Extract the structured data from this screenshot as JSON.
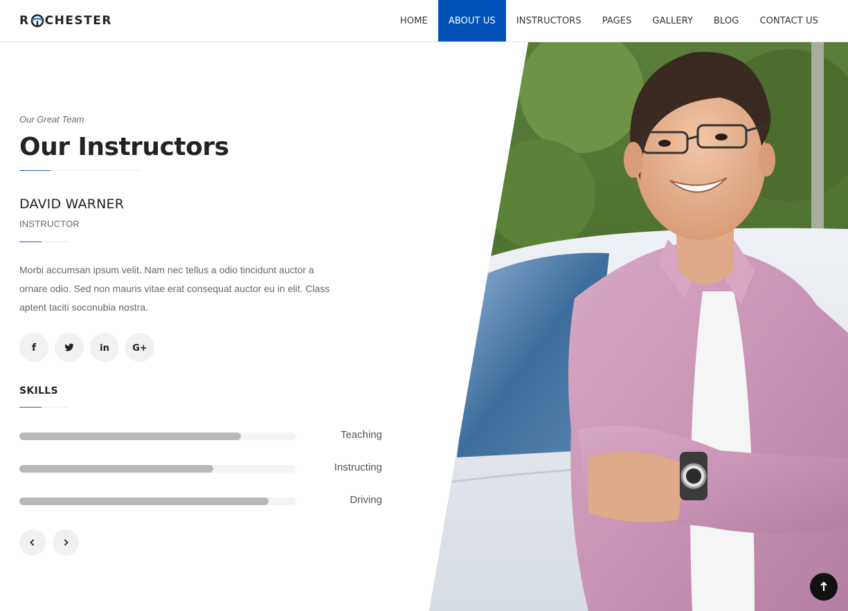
{
  "header": {
    "logo_left": "R",
    "logo_right": "CHESTER",
    "nav": [
      {
        "label": "HOME"
      },
      {
        "label": "ABOUT US"
      },
      {
        "label": "INSTRUCTORS"
      },
      {
        "label": "PAGES"
      },
      {
        "label": "GALLERY"
      },
      {
        "label": "BLOG"
      },
      {
        "label": "CONTACT US"
      }
    ],
    "active_nav": "ABOUT US"
  },
  "section": {
    "eyebrow": "Our Great Team",
    "title": "Our Instructors"
  },
  "instructor": {
    "name": "DAVID WARNER",
    "role": "INSTRUCTOR",
    "bio": "Morbi accumsan ipsum velit. Nam nec tellus a odio tincidunt auctor a ornare odio. Sed non mauris vitae erat consequat auctor eu in elit. Class aptent taciti soconubia nostra."
  },
  "socials": [
    {
      "icon": "facebook-icon",
      "glyph": "f"
    },
    {
      "icon": "twitter-icon"
    },
    {
      "icon": "linkedin-icon",
      "glyph": "in"
    },
    {
      "icon": "google-plus-icon",
      "glyph": "G+"
    }
  ],
  "skills": {
    "title": "SKILLS",
    "items": [
      {
        "label": "Teaching",
        "level": 0.8
      },
      {
        "label": "Instructing",
        "level": 0.7
      },
      {
        "label": "Driving",
        "level": 0.9
      }
    ]
  },
  "controls": {
    "prev_icon": "chevron-left-icon",
    "next_icon": "chevron-right-icon",
    "to_top_icon": "arrow-up-icon"
  },
  "colors": {
    "accent": "#0051b8",
    "bar_fill": "#b9b9b9",
    "bar_track": "#f3f3f3"
  }
}
